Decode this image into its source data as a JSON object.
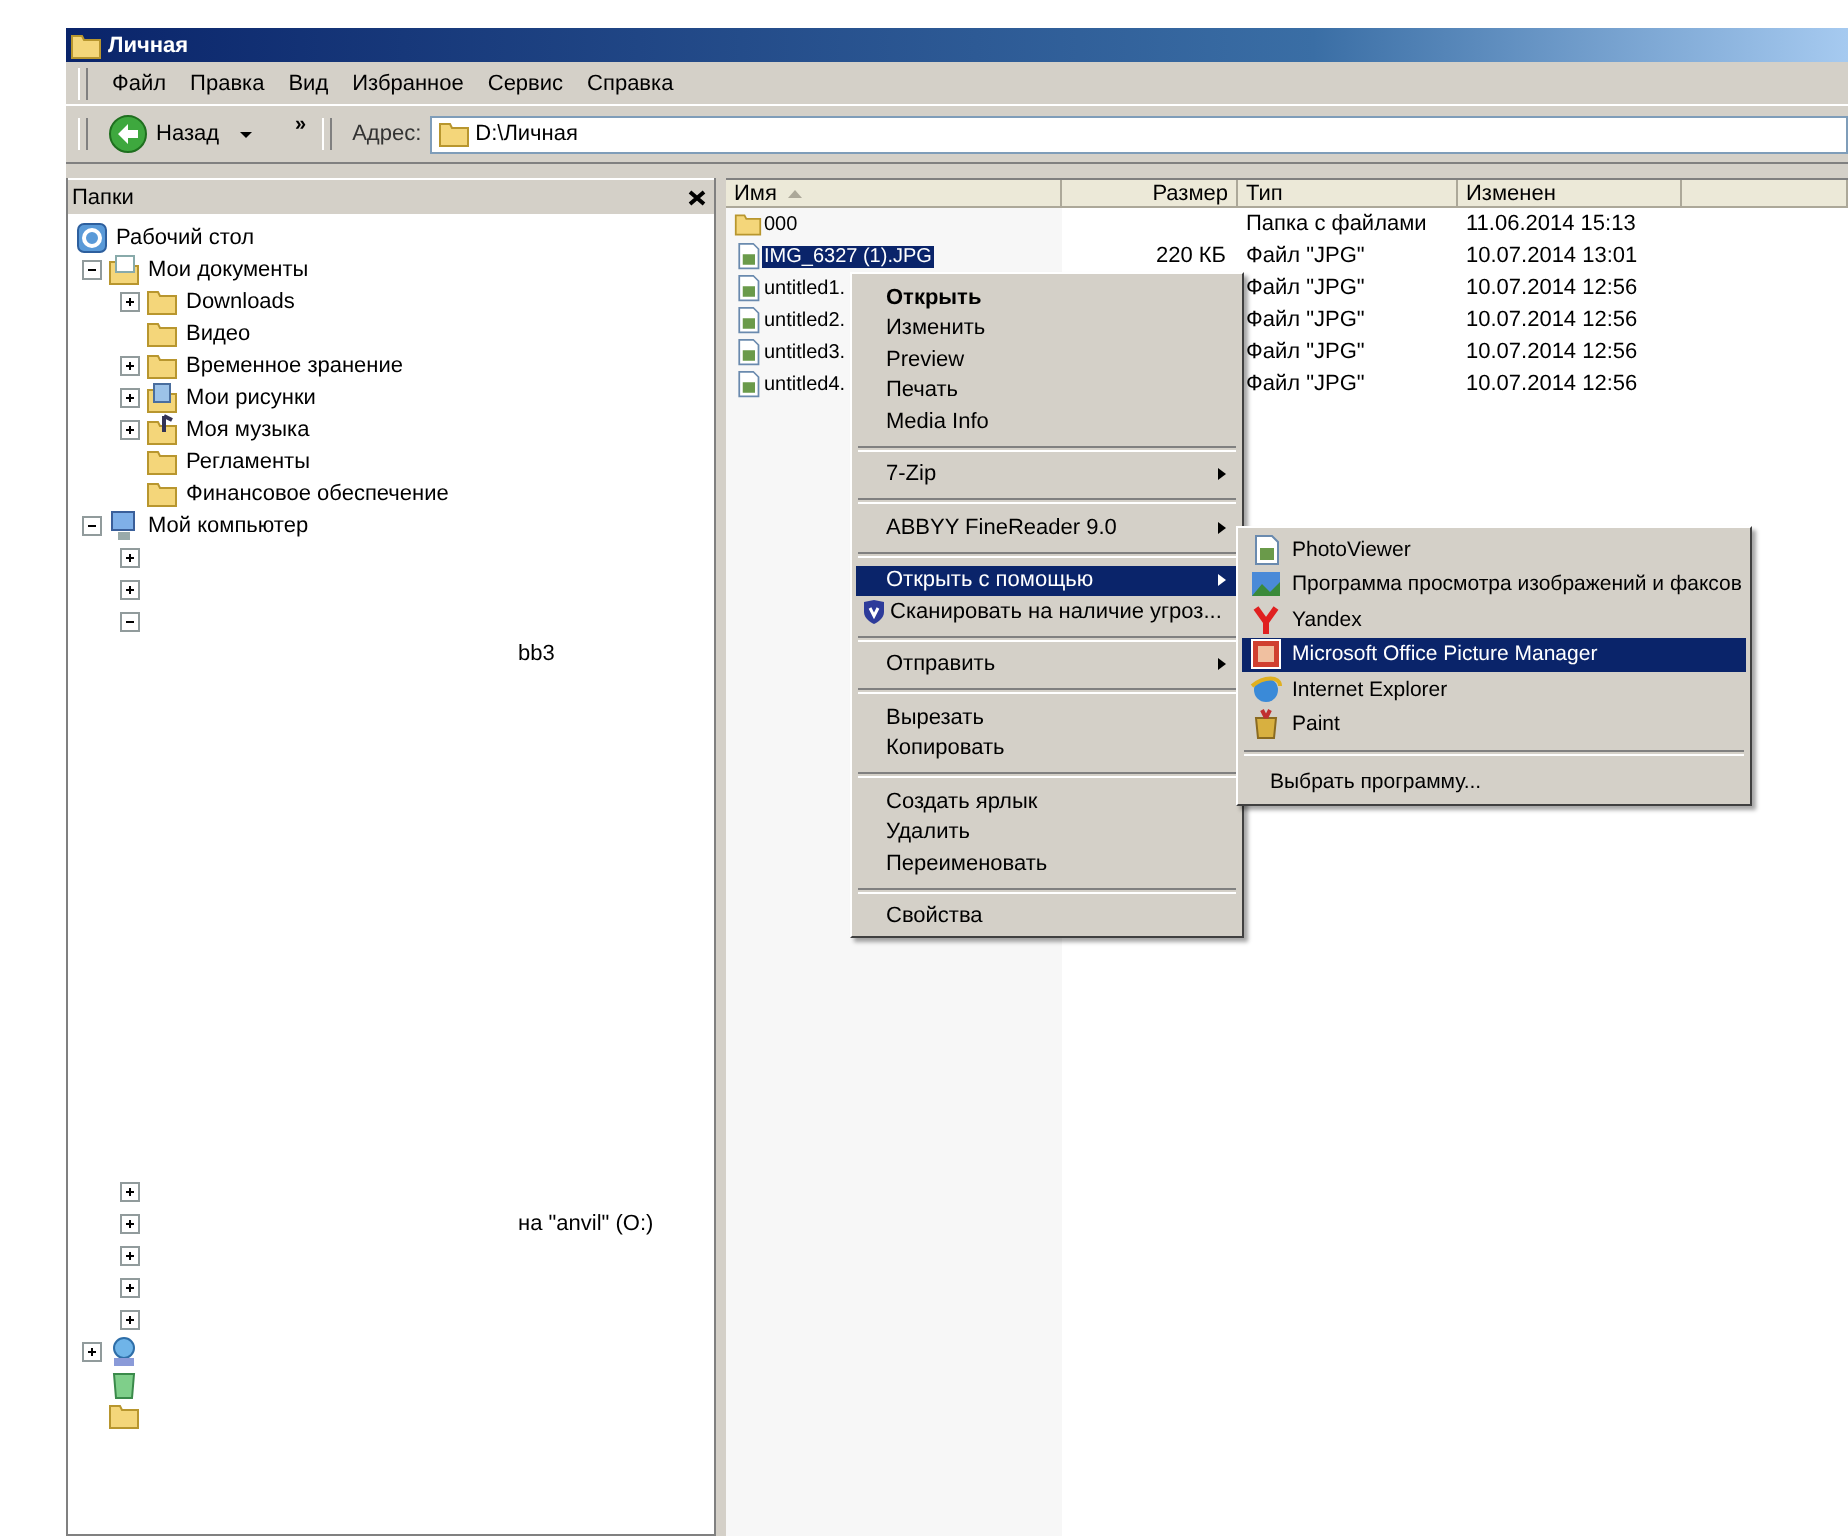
{
  "window": {
    "title": "Личная"
  },
  "menu_bar": [
    "Файл",
    "Правка",
    "Вид",
    "Избранное",
    "Сервис",
    "Справка"
  ],
  "toolbar": {
    "back_label": "Назад",
    "chevron": "»",
    "address_label": "Адрес:",
    "address": "D:\\Личная"
  },
  "folders_pane": {
    "title": "Папки",
    "tree": [
      {
        "kind": "desktop",
        "label": "Рабочий стол"
      },
      {
        "kind": "documents",
        "label": "Мои документы",
        "expanded": true,
        "children": [
          {
            "kind": "folder",
            "label": "Downloads",
            "expanded": false
          },
          {
            "kind": "folder",
            "label": "Видео"
          },
          {
            "kind": "folder",
            "label": "Временное зранение",
            "expanded": false
          },
          {
            "kind": "pictures",
            "label": "Мои рисунки",
            "expanded": false
          },
          {
            "kind": "music",
            "label": "Моя музыка",
            "expanded": false
          },
          {
            "kind": "folder",
            "label": "Регламенты"
          },
          {
            "kind": "folder",
            "label": "Финансовое обеспечение"
          }
        ]
      },
      {
        "kind": "computer",
        "label": "Мой компьютер",
        "expanded": true,
        "children": [
          {
            "kind": "drive",
            "expanded": false
          },
          {
            "kind": "drive",
            "expanded": false
          },
          {
            "kind": "drive",
            "expanded": true
          },
          {
            "kind": "note",
            "note": "bb3"
          }
        ]
      }
    ],
    "tree_lower": [
      {
        "kind": "drive",
        "expanded": false
      },
      {
        "kind": "drive",
        "expanded": false,
        "note": "на \"anvil\" (O:)"
      },
      {
        "kind": "drive",
        "expanded": false
      },
      {
        "kind": "drive",
        "expanded": false
      },
      {
        "kind": "drive",
        "expanded": false
      },
      {
        "kind": "network",
        "expanded": false
      },
      {
        "kind": "recycle"
      },
      {
        "kind": "folder"
      }
    ]
  },
  "file_list": {
    "columns": [
      {
        "label": "Имя",
        "sorted": true
      },
      {
        "label": "Размер",
        "sorted": false
      },
      {
        "label": "Тип",
        "sorted": false
      },
      {
        "label": "Изменен",
        "sorted": false
      }
    ],
    "rows": [
      {
        "kind": "folder",
        "name": "000",
        "type": "Папка с файлами",
        "modified": "11.06.2014 15:13",
        "selected": false
      },
      {
        "kind": "image",
        "name": "IMG_6327 (1).JPG",
        "size": "220 КБ",
        "type": "Файл \"JPG\"",
        "modified": "10.07.2014 13:01",
        "selected": true
      },
      {
        "kind": "image",
        "name": "untitled1.",
        "type": "Файл \"JPG\"",
        "modified": "10.07.2014 12:56",
        "selected": false
      },
      {
        "kind": "image",
        "name": "untitled2.",
        "type": "Файл \"JPG\"",
        "modified": "10.07.2014 12:56",
        "selected": false
      },
      {
        "kind": "image",
        "name": "untitled3.",
        "type": "Файл \"JPG\"",
        "modified": "10.07.2014 12:56",
        "selected": false
      },
      {
        "kind": "image",
        "name": "untitled4.",
        "type": "Файл \"JPG\"",
        "modified": "10.07.2014 12:56",
        "selected": false
      }
    ]
  },
  "context_menu": {
    "items": [
      {
        "kind": "item",
        "label": "Открыть",
        "default": true,
        "selected": false
      },
      {
        "kind": "item",
        "label": "Изменить",
        "default": false,
        "selected": false
      },
      {
        "kind": "item",
        "label": "Preview",
        "default": false,
        "selected": false
      },
      {
        "kind": "item",
        "label": "Печать",
        "default": false,
        "selected": false
      },
      {
        "kind": "item",
        "label": "Media Info",
        "default": false,
        "selected": false
      },
      {
        "kind": "separator"
      },
      {
        "kind": "submenu",
        "label": "7-Zip",
        "default": false,
        "selected": false
      },
      {
        "kind": "separator"
      },
      {
        "kind": "submenu",
        "label": "ABBYY FineReader 9.0",
        "default": false,
        "selected": false
      },
      {
        "kind": "separator"
      },
      {
        "kind": "submenu",
        "label": "Открыть с помощью",
        "default": false,
        "selected": true
      },
      {
        "kind": "shield",
        "label": "Сканировать на наличие угроз...",
        "default": false,
        "selected": false
      },
      {
        "kind": "separator"
      },
      {
        "kind": "submenu",
        "label": "Отправить",
        "default": false,
        "selected": false
      },
      {
        "kind": "separator"
      },
      {
        "kind": "item",
        "label": "Вырезать",
        "default": false,
        "selected": false
      },
      {
        "kind": "item",
        "label": "Копировать",
        "default": false,
        "selected": false
      },
      {
        "kind": "separator"
      },
      {
        "kind": "item",
        "label": "Создать ярлык",
        "default": false,
        "selected": false
      },
      {
        "kind": "item",
        "label": "Удалить",
        "default": false,
        "selected": false
      },
      {
        "kind": "item",
        "label": "Переименовать",
        "default": false,
        "selected": false
      },
      {
        "kind": "separator"
      },
      {
        "kind": "item",
        "label": "Свойства",
        "default": false,
        "selected": false
      }
    ]
  },
  "open_with_menu": {
    "items": [
      {
        "kind": "photoviewer",
        "label": "PhotoViewer",
        "selected": false
      },
      {
        "kind": "faxviewer",
        "label": "Программа просмотра изображений и факсов",
        "selected": false
      },
      {
        "kind": "yandex",
        "label": "Yandex",
        "selected": false
      },
      {
        "kind": "picturemanager",
        "label": "Microsoft Office Picture Manager",
        "selected": true
      },
      {
        "kind": "ie",
        "label": "Internet Explorer",
        "selected": false
      },
      {
        "kind": "paint",
        "label": "Paint",
        "selected": false
      },
      {
        "kind": "separator"
      },
      {
        "kind": "item",
        "label": "Выбрать программу...",
        "selected": false
      }
    ]
  }
}
